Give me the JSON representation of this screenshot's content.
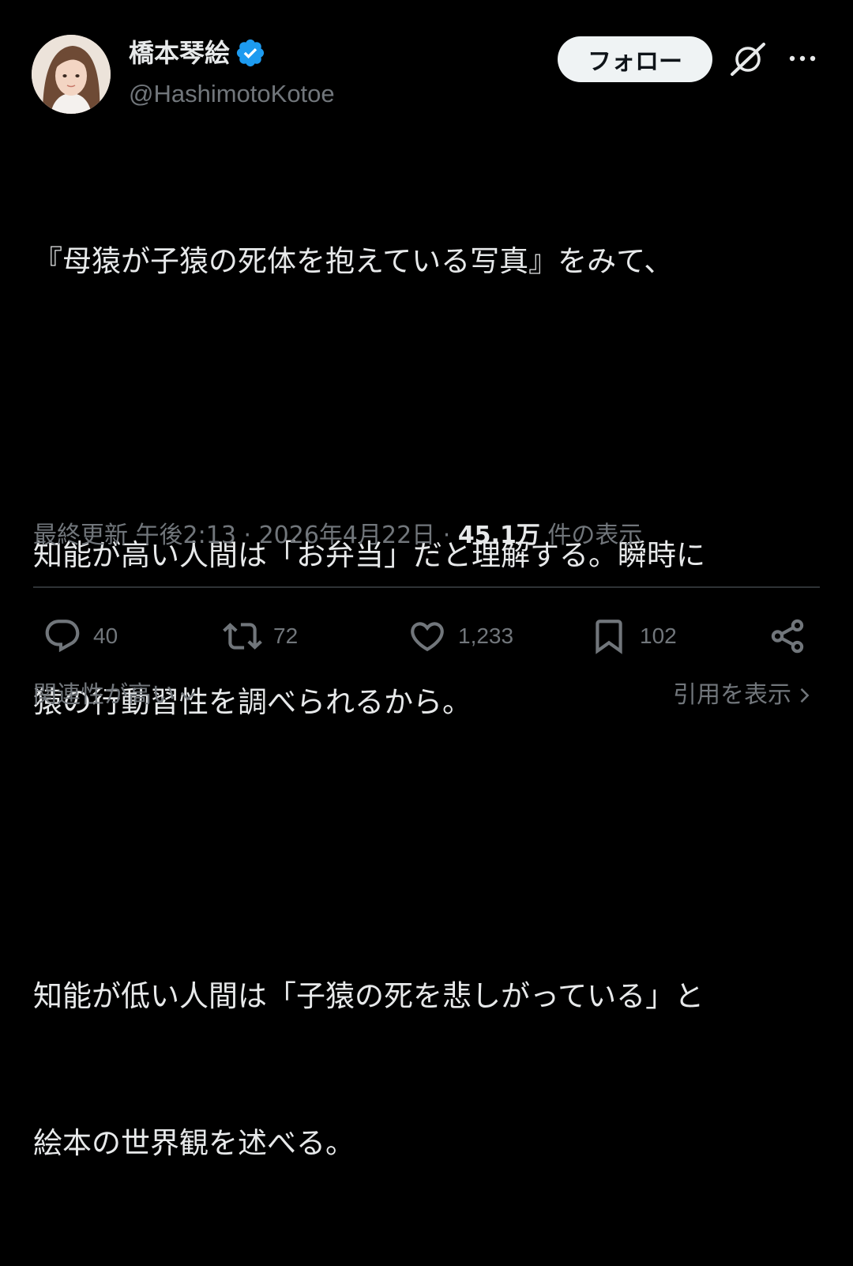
{
  "author": {
    "name": "橋本琴絵",
    "handle": "@HashimotoKotoe"
  },
  "header": {
    "follow_label": "フォロー"
  },
  "tweet": {
    "lines": [
      "『母猿が子猿の死体を抱えている写真』をみて、",
      "",
      "知能が高い人間は「お弁当」だと理解する。瞬時に",
      "猿の行動習性を調べられるから。",
      "",
      "知能が低い人間は「子猿の死を悲しがっている」と",
      "絵本の世界観を述べる。"
    ]
  },
  "meta": {
    "updated_label": "最終更新",
    "time": "午後2:13",
    "separator": "·",
    "date": "2026年4月22日",
    "views_count": "45.1万",
    "views_label": "件の表示"
  },
  "actions": {
    "replies": "40",
    "reposts": "72",
    "likes": "1,233",
    "bookmarks": "102"
  },
  "footer": {
    "sort_label": "関連性が高い",
    "quotes_label": "引用を表示"
  },
  "colors": {
    "background": "#000000",
    "text_primary": "#e7e9ea",
    "text_secondary": "#71767b",
    "verified_blue": "#1d9bf0",
    "divider": "#2f3336"
  },
  "icons": {
    "verified": "verified-badge-icon",
    "grok": "grok-icon",
    "more": "more-icon",
    "reply": "reply-icon",
    "repost": "repost-icon",
    "like": "heart-icon",
    "bookmark": "bookmark-icon",
    "share": "share-icon"
  }
}
